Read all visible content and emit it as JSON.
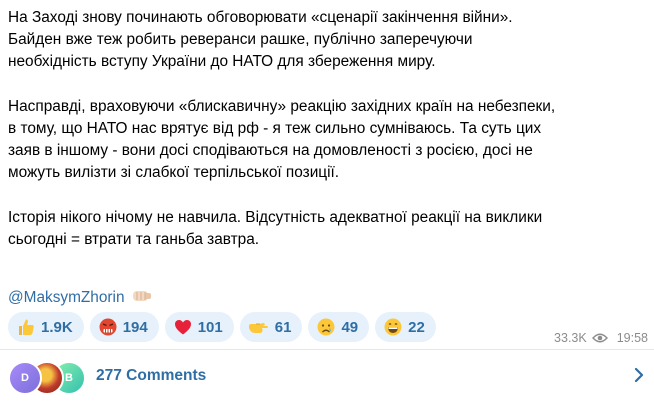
{
  "message": {
    "paragraphs": [
      [
        "На Заході знову починають обговорювати «сценарії закінчення війни».",
        "Байден вже теж робить реверанси рашке, публічно заперечуючи",
        "необхідність вступу України до НАТО для збереження миру."
      ],
      [
        "Насправді, враховуючи «блискавичну» реакцію західних країн на небезпеки,",
        "в тому, що НАТО нас врятує від рф - я теж сильно сумніваюсь. Та суть цих",
        "заяв в іншому - вони досі сподіваються на домовленості з росією, досі не",
        "можуть вилізти зі слабкої терпільської позиції."
      ],
      [
        "Історія нікого нічому не навчила. Відсутність адекватної реакції на виклики",
        "сьогодні = втрати та ганьба завтра."
      ]
    ],
    "mention": "@MaksymZhorin",
    "mention_icon": "fist-emoji"
  },
  "reactions": [
    {
      "icon": "thumbs-up-emoji",
      "count": "1.9K"
    },
    {
      "icon": "angry-face-emoji",
      "count": "194"
    },
    {
      "icon": "red-heart-emoji",
      "count": "101"
    },
    {
      "icon": "pointing-hand-emoji",
      "count": "61"
    },
    {
      "icon": "crying-face-emoji",
      "count": "49"
    },
    {
      "icon": "grinning-face-emoji",
      "count": "22"
    }
  ],
  "meta": {
    "views": "33.3K",
    "time": "19:58"
  },
  "comments": {
    "label": "277 Comments",
    "avatars": [
      {
        "letter": "D"
      },
      {
        "letter": ""
      },
      {
        "letter": "B"
      }
    ]
  },
  "colors": {
    "accent": "#2f6ea5",
    "reaction_bg": "#e6f1fb",
    "meta": "#8c8c8c"
  }
}
